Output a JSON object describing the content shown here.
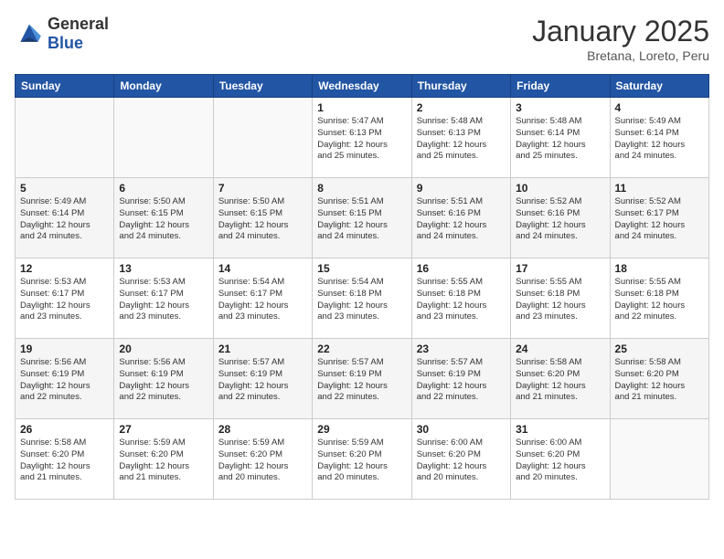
{
  "header": {
    "logo": {
      "text_general": "General",
      "text_blue": "Blue"
    },
    "title": "January 2025",
    "subtitle": "Bretana, Loreto, Peru"
  },
  "calendar": {
    "days_of_week": [
      "Sunday",
      "Monday",
      "Tuesday",
      "Wednesday",
      "Thursday",
      "Friday",
      "Saturday"
    ],
    "weeks": [
      [
        {
          "day": "",
          "info": ""
        },
        {
          "day": "",
          "info": ""
        },
        {
          "day": "",
          "info": ""
        },
        {
          "day": "1",
          "info": "Sunrise: 5:47 AM\nSunset: 6:13 PM\nDaylight: 12 hours\nand 25 minutes."
        },
        {
          "day": "2",
          "info": "Sunrise: 5:48 AM\nSunset: 6:13 PM\nDaylight: 12 hours\nand 25 minutes."
        },
        {
          "day": "3",
          "info": "Sunrise: 5:48 AM\nSunset: 6:14 PM\nDaylight: 12 hours\nand 25 minutes."
        },
        {
          "day": "4",
          "info": "Sunrise: 5:49 AM\nSunset: 6:14 PM\nDaylight: 12 hours\nand 24 minutes."
        }
      ],
      [
        {
          "day": "5",
          "info": "Sunrise: 5:49 AM\nSunset: 6:14 PM\nDaylight: 12 hours\nand 24 minutes."
        },
        {
          "day": "6",
          "info": "Sunrise: 5:50 AM\nSunset: 6:15 PM\nDaylight: 12 hours\nand 24 minutes."
        },
        {
          "day": "7",
          "info": "Sunrise: 5:50 AM\nSunset: 6:15 PM\nDaylight: 12 hours\nand 24 minutes."
        },
        {
          "day": "8",
          "info": "Sunrise: 5:51 AM\nSunset: 6:15 PM\nDaylight: 12 hours\nand 24 minutes."
        },
        {
          "day": "9",
          "info": "Sunrise: 5:51 AM\nSunset: 6:16 PM\nDaylight: 12 hours\nand 24 minutes."
        },
        {
          "day": "10",
          "info": "Sunrise: 5:52 AM\nSunset: 6:16 PM\nDaylight: 12 hours\nand 24 minutes."
        },
        {
          "day": "11",
          "info": "Sunrise: 5:52 AM\nSunset: 6:17 PM\nDaylight: 12 hours\nand 24 minutes."
        }
      ],
      [
        {
          "day": "12",
          "info": "Sunrise: 5:53 AM\nSunset: 6:17 PM\nDaylight: 12 hours\nand 23 minutes."
        },
        {
          "day": "13",
          "info": "Sunrise: 5:53 AM\nSunset: 6:17 PM\nDaylight: 12 hours\nand 23 minutes."
        },
        {
          "day": "14",
          "info": "Sunrise: 5:54 AM\nSunset: 6:17 PM\nDaylight: 12 hours\nand 23 minutes."
        },
        {
          "day": "15",
          "info": "Sunrise: 5:54 AM\nSunset: 6:18 PM\nDaylight: 12 hours\nand 23 minutes."
        },
        {
          "day": "16",
          "info": "Sunrise: 5:55 AM\nSunset: 6:18 PM\nDaylight: 12 hours\nand 23 minutes."
        },
        {
          "day": "17",
          "info": "Sunrise: 5:55 AM\nSunset: 6:18 PM\nDaylight: 12 hours\nand 23 minutes."
        },
        {
          "day": "18",
          "info": "Sunrise: 5:55 AM\nSunset: 6:18 PM\nDaylight: 12 hours\nand 22 minutes."
        }
      ],
      [
        {
          "day": "19",
          "info": "Sunrise: 5:56 AM\nSunset: 6:19 PM\nDaylight: 12 hours\nand 22 minutes."
        },
        {
          "day": "20",
          "info": "Sunrise: 5:56 AM\nSunset: 6:19 PM\nDaylight: 12 hours\nand 22 minutes."
        },
        {
          "day": "21",
          "info": "Sunrise: 5:57 AM\nSunset: 6:19 PM\nDaylight: 12 hours\nand 22 minutes."
        },
        {
          "day": "22",
          "info": "Sunrise: 5:57 AM\nSunset: 6:19 PM\nDaylight: 12 hours\nand 22 minutes."
        },
        {
          "day": "23",
          "info": "Sunrise: 5:57 AM\nSunset: 6:19 PM\nDaylight: 12 hours\nand 22 minutes."
        },
        {
          "day": "24",
          "info": "Sunrise: 5:58 AM\nSunset: 6:20 PM\nDaylight: 12 hours\nand 21 minutes."
        },
        {
          "day": "25",
          "info": "Sunrise: 5:58 AM\nSunset: 6:20 PM\nDaylight: 12 hours\nand 21 minutes."
        }
      ],
      [
        {
          "day": "26",
          "info": "Sunrise: 5:58 AM\nSunset: 6:20 PM\nDaylight: 12 hours\nand 21 minutes."
        },
        {
          "day": "27",
          "info": "Sunrise: 5:59 AM\nSunset: 6:20 PM\nDaylight: 12 hours\nand 21 minutes."
        },
        {
          "day": "28",
          "info": "Sunrise: 5:59 AM\nSunset: 6:20 PM\nDaylight: 12 hours\nand 20 minutes."
        },
        {
          "day": "29",
          "info": "Sunrise: 5:59 AM\nSunset: 6:20 PM\nDaylight: 12 hours\nand 20 minutes."
        },
        {
          "day": "30",
          "info": "Sunrise: 6:00 AM\nSunset: 6:20 PM\nDaylight: 12 hours\nand 20 minutes."
        },
        {
          "day": "31",
          "info": "Sunrise: 6:00 AM\nSunset: 6:20 PM\nDaylight: 12 hours\nand 20 minutes."
        },
        {
          "day": "",
          "info": ""
        }
      ]
    ]
  }
}
